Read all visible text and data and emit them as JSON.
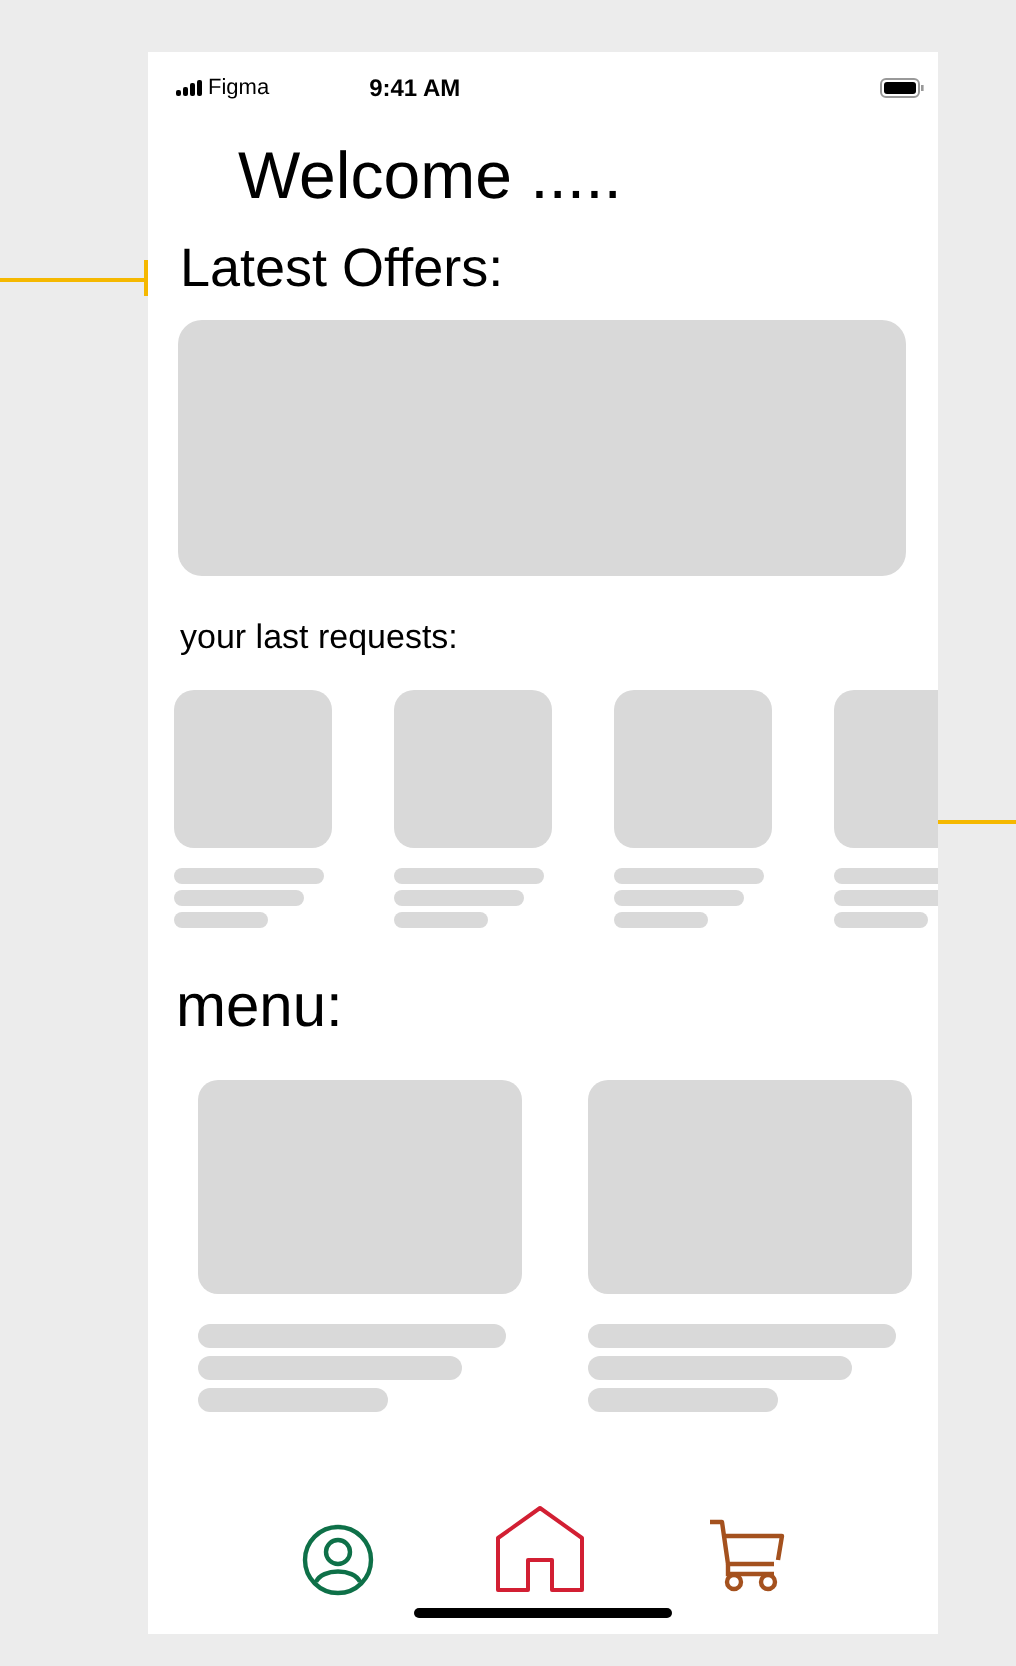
{
  "status_bar": {
    "carrier": "Figma",
    "time": "9:41 AM"
  },
  "greeting": "Welcome .....",
  "offers": {
    "title": "Latest Offers:",
    "banner": {
      "kind": "placeholder"
    }
  },
  "requests": {
    "title": "your last requests:",
    "items": [
      {
        "kind": "placeholder"
      },
      {
        "kind": "placeholder"
      },
      {
        "kind": "placeholder"
      },
      {
        "kind": "placeholder"
      }
    ]
  },
  "menu": {
    "title": "menu:",
    "items": [
      {
        "kind": "placeholder"
      },
      {
        "kind": "placeholder"
      }
    ]
  },
  "tab_bar": [
    {
      "kind": "profile",
      "color": "#0e7048"
    },
    {
      "kind": "home",
      "color": "#d21f33"
    },
    {
      "kind": "cart",
      "color": "#a4511e"
    }
  ]
}
